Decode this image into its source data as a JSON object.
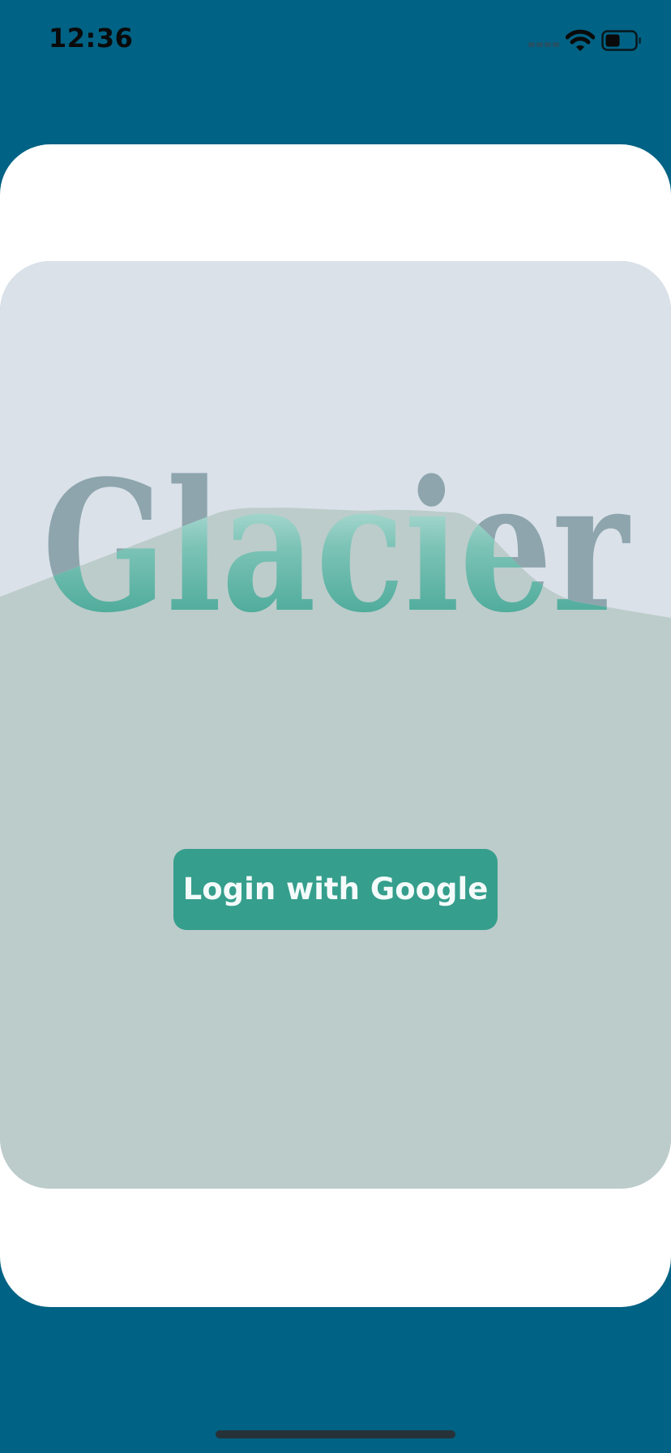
{
  "status_bar": {
    "time": "12:36",
    "icons": [
      "signal-icon",
      "wifi-icon",
      "battery-icon"
    ]
  },
  "app": {
    "title": "Glacier"
  },
  "login": {
    "button_label": "Login with Google"
  },
  "colors": {
    "background": "#006284",
    "card": "#ffffff",
    "sky": "#dae1e9",
    "ice": "#bccccb",
    "title_gray": "#8ea5ad",
    "accent_teal": "#359e8c",
    "home_indicator": "#263238"
  }
}
